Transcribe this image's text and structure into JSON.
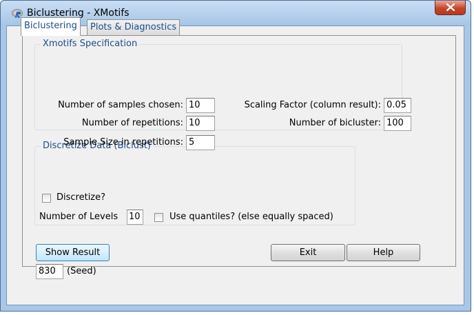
{
  "window": {
    "title": "Biclustering - XMotifs",
    "close_label": "X"
  },
  "tabs": [
    {
      "label": "Biclustering",
      "active": true
    },
    {
      "label": "Plots & Diagnostics",
      "active": false
    }
  ],
  "xmotifs": {
    "group_title": "Xmotifs Specification",
    "samples_label": "Number of samples chosen:",
    "samples_value": "10",
    "repetitions_label": "Number of repetitions:",
    "repetitions_value": "10",
    "sample_size_label": "Sample Size in repetitions:",
    "sample_size_value": "5",
    "scaling_label": "Scaling Factor (column result):",
    "scaling_value": "0.05",
    "bicluster_label": "Number of bicluster:",
    "bicluster_value": "100"
  },
  "discretize": {
    "group_title": "Discretize Data (Biclust)",
    "discretize_label": "Discretize?",
    "discretize_checked": false,
    "levels_label": "Number of Levels",
    "levels_value": "10",
    "quantiles_label": "Use quantiles? (else equally spaced)",
    "quantiles_checked": false
  },
  "buttons": {
    "show_result": "Show Result",
    "exit": "Exit",
    "help": "Help"
  },
  "seed": {
    "value": "830",
    "label": "(Seed)"
  }
}
